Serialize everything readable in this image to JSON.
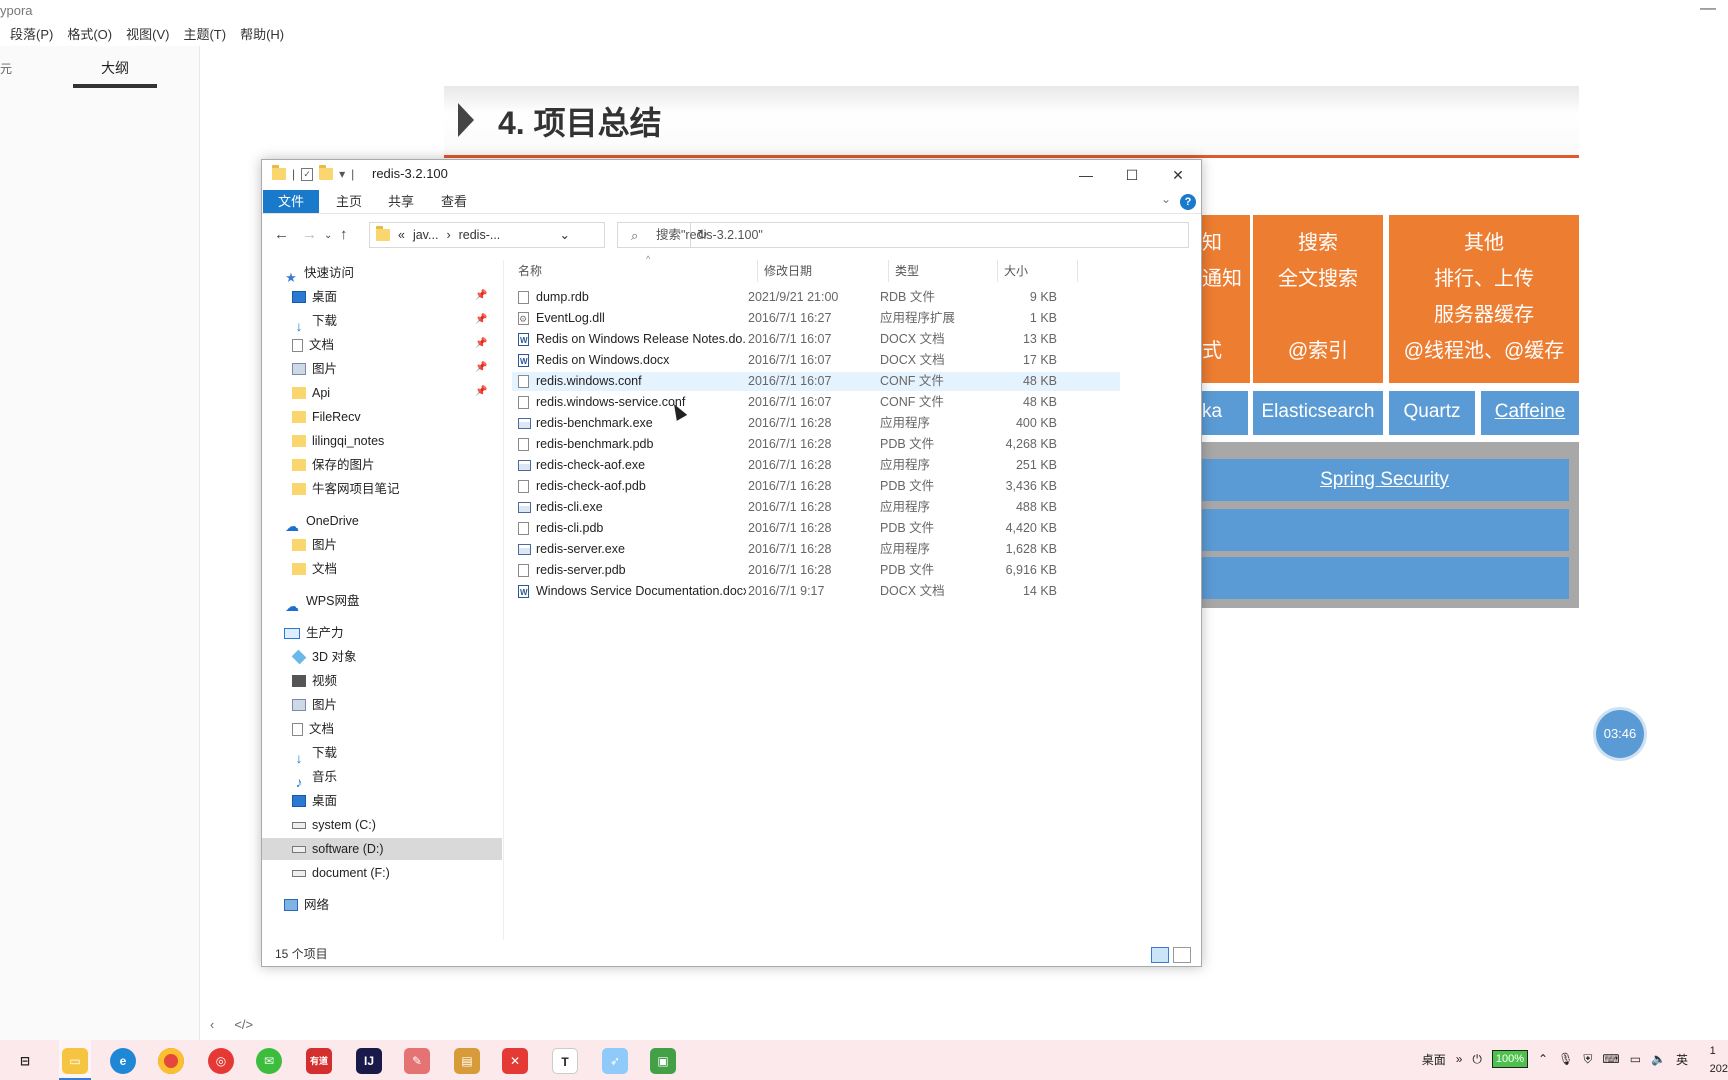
{
  "app": {
    "title_fragment": "ypora",
    "menu": [
      "段落(P)",
      "格式(O)",
      "视图(V)",
      "主题(T)",
      "帮助(H)"
    ],
    "sidebar_tab": "大纲",
    "sidebar_left_char": "元"
  },
  "slide": {
    "title": "4. 项目总结",
    "boxes": [
      {
        "lines": [
          "知",
          "通知",
          "",
          "式"
        ]
      },
      {
        "lines": [
          "搜索",
          "全文搜索",
          "",
          "@索引"
        ]
      },
      {
        "lines": [
          "其他",
          "排行、上传",
          "服务器缓存",
          "@线程池、@缓存"
        ]
      }
    ],
    "chips": [
      "ka",
      "Elasticsearch",
      "Quartz",
      "Caffeine"
    ],
    "bars": [
      "Spring Security",
      "",
      ""
    ]
  },
  "timer": "03:46",
  "explorer": {
    "title": "redis-3.2.100",
    "ribbon_tabs": [
      "文件",
      "主页",
      "共享",
      "查看"
    ],
    "address": {
      "prefix": "«",
      "parts": [
        "jav...",
        "redis-..."
      ]
    },
    "search_placeholder": "搜索\"redis-3.2.100\"",
    "nav": {
      "quick_access": "快速访问",
      "pinned": [
        "桌面",
        "下载",
        "文档",
        "图片",
        "Api"
      ],
      "folders": [
        "FileRecv",
        "lilingqi_notes",
        "保存的图片",
        "牛客网项目笔记"
      ],
      "onedrive": "OneDrive",
      "onedrive_items": [
        "图片",
        "文档"
      ],
      "wps": "WPS网盘",
      "pc": "生产力",
      "pc_items": [
        "3D 对象",
        "视频",
        "图片",
        "文档",
        "下载",
        "音乐",
        "桌面"
      ],
      "drives": [
        "system (C:)",
        "software (D:)",
        "document (F:)"
      ],
      "network": "网络"
    },
    "columns": [
      "名称",
      "修改日期",
      "类型",
      "大小"
    ],
    "files": [
      {
        "name": "dump.rdb",
        "date": "2021/9/21 21:00",
        "type": "RDB 文件",
        "size": "9 KB",
        "icon": "file"
      },
      {
        "name": "EventLog.dll",
        "date": "2016/7/1 16:27",
        "type": "应用程序扩展",
        "size": "1 KB",
        "icon": "dll"
      },
      {
        "name": "Redis on Windows Release Notes.do...",
        "date": "2016/7/1 16:07",
        "type": "DOCX 文档",
        "size": "13 KB",
        "icon": "docx"
      },
      {
        "name": "Redis on Windows.docx",
        "date": "2016/7/1 16:07",
        "type": "DOCX 文档",
        "size": "17 KB",
        "icon": "docx"
      },
      {
        "name": "redis.windows.conf",
        "date": "2016/7/1 16:07",
        "type": "CONF 文件",
        "size": "48 KB",
        "icon": "file"
      },
      {
        "name": "redis.windows-service.conf",
        "date": "2016/7/1 16:07",
        "type": "CONF 文件",
        "size": "48 KB",
        "icon": "file"
      },
      {
        "name": "redis-benchmark.exe",
        "date": "2016/7/1 16:28",
        "type": "应用程序",
        "size": "400 KB",
        "icon": "exe"
      },
      {
        "name": "redis-benchmark.pdb",
        "date": "2016/7/1 16:28",
        "type": "PDB 文件",
        "size": "4,268 KB",
        "icon": "file"
      },
      {
        "name": "redis-check-aof.exe",
        "date": "2016/7/1 16:28",
        "type": "应用程序",
        "size": "251 KB",
        "icon": "exe"
      },
      {
        "name": "redis-check-aof.pdb",
        "date": "2016/7/1 16:28",
        "type": "PDB 文件",
        "size": "3,436 KB",
        "icon": "file"
      },
      {
        "name": "redis-cli.exe",
        "date": "2016/7/1 16:28",
        "type": "应用程序",
        "size": "488 KB",
        "icon": "exe"
      },
      {
        "name": "redis-cli.pdb",
        "date": "2016/7/1 16:28",
        "type": "PDB 文件",
        "size": "4,420 KB",
        "icon": "file"
      },
      {
        "name": "redis-server.exe",
        "date": "2016/7/1 16:28",
        "type": "应用程序",
        "size": "1,628 KB",
        "icon": "exe"
      },
      {
        "name": "redis-server.pdb",
        "date": "2016/7/1 16:28",
        "type": "PDB 文件",
        "size": "6,916 KB",
        "icon": "file"
      },
      {
        "name": "Windows Service Documentation.docx",
        "date": "2016/7/1 9:17",
        "type": "DOCX 文档",
        "size": "14 KB",
        "icon": "docx"
      }
    ],
    "status": "15 个项目"
  },
  "taskbar": {
    "desktop_label": "桌面",
    "battery": "100%",
    "ime": "英",
    "clock_fragment": "202"
  },
  "colors": {
    "accent_blue": "#1979ca",
    "orange": "#ed7d31",
    "slide_blue": "#5b9bd5"
  }
}
